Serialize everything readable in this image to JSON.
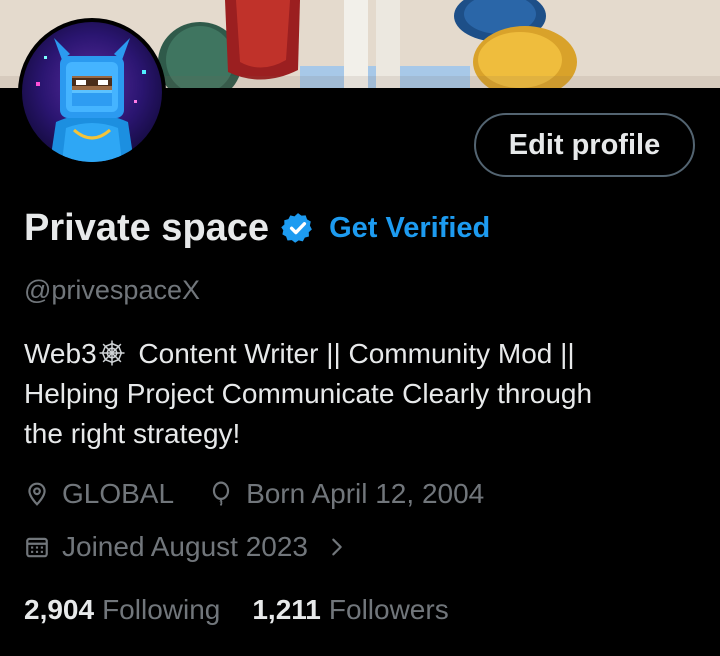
{
  "profile": {
    "display_name": "Private space",
    "get_verified_label": "Get Verified",
    "handle": "@privespaceX",
    "edit_profile_label": "Edit profile",
    "bio_lines": [
      "Content Writer || Community Mod ||",
      "Helping Project Communicate Clearly through",
      "the right strategy!"
    ],
    "bio_prefix": "Web3",
    "location": "GLOBAL",
    "birthday": "Born April 12, 2004",
    "joined": "Joined August 2023",
    "following_count": "2,904",
    "following_label": "Following",
    "followers_count": "1,211",
    "followers_label": "Followers"
  },
  "icons": {
    "verified": "verified-badge-icon",
    "bio_emoji": "spider-web-icon",
    "location": "location-pin-icon",
    "birthday": "balloon-icon",
    "joined": "calendar-icon",
    "chevron": "chevron-right-icon"
  },
  "colors": {
    "background": "#000000",
    "accent": "#1d9bf0",
    "muted_text": "#71767b",
    "primary_text": "#e7e9ea"
  }
}
